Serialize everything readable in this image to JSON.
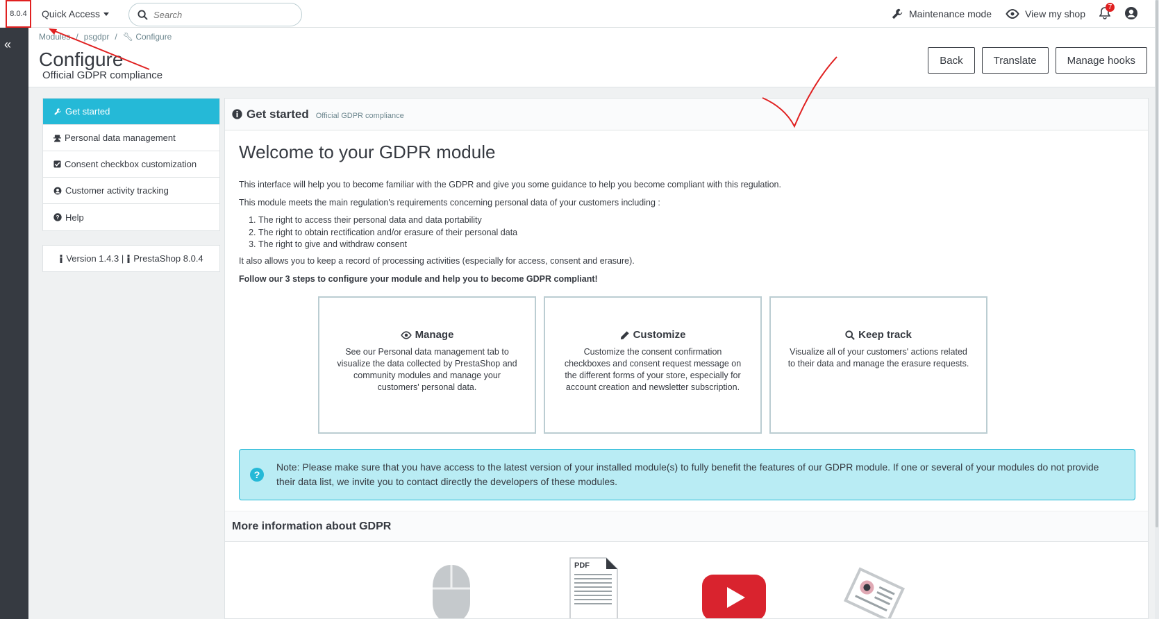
{
  "header": {
    "version": "8.0.4",
    "quick_access": "Quick Access",
    "search_placeholder": "Search",
    "maintenance": "Maintenance mode",
    "view_shop": "View my shop",
    "notifications_count": "7"
  },
  "breadcrumb": {
    "items": [
      "Modules",
      "psgdpr",
      "Configure"
    ]
  },
  "page": {
    "title": "Configure",
    "subtitle": "Official GDPR compliance",
    "actions": {
      "back": "Back",
      "translate": "Translate",
      "manage_hooks": "Manage hooks"
    }
  },
  "nav": {
    "items": [
      {
        "label": "Get started",
        "icon": "wrench-icon"
      },
      {
        "label": "Personal data management",
        "icon": "user-secret-icon"
      },
      {
        "label": "Consent checkbox customization",
        "icon": "checkbox-icon"
      },
      {
        "label": "Customer activity tracking",
        "icon": "user-circle-icon"
      },
      {
        "label": "Help",
        "icon": "question-circle-icon"
      }
    ],
    "version_text": "Version 1.4.3 |",
    "prestashop_text": "PrestaShop 8.0.4"
  },
  "main": {
    "panel_title": "Get started",
    "panel_subtitle": "Official GDPR compliance",
    "welcome": "Welcome to your GDPR module",
    "p1": "This interface will help you to become familiar with the GDPR and give you some guidance to help you become compliant with this regulation.",
    "p2": "This module meets the main regulation's requirements concerning personal data of your customers including :",
    "rights": [
      "The right to access their personal data and data portability",
      "The right to obtain rectification and/or erasure of their personal data",
      "The right to give and withdraw consent"
    ],
    "p3": "It also allows you to keep a record of processing activities (especially for access, consent and erasure).",
    "p4": "Follow our 3 steps to configure your module and help you to become GDPR compliant!",
    "cards": [
      {
        "title": "Manage",
        "icon": "eye-icon",
        "text": "See our Personal data management tab to visualize the data collected by PrestaShop and community modules and manage your customers' personal data."
      },
      {
        "title": "Customize",
        "icon": "pencil-icon",
        "text": "Customize the consent confirmation checkboxes and consent request message on the different forms of your store, especially for account creation and newsletter subscription."
      },
      {
        "title": "Keep track",
        "icon": "search-icon",
        "text": "Visualize all of your customers' actions related to their data and manage the erasure requests."
      }
    ],
    "note": "Note: Please make sure that you have access to the latest version of your installed module(s) to fully benefit the features of our GDPR module. If one or several of your modules do not provide their data list, we invite you to contact directly the developers of these modules.",
    "more_title": "More information about GDPR",
    "more_icons": [
      "mouse-icon",
      "pdf-icon",
      "youtube-icon",
      "newspaper-icon"
    ],
    "pdf_label": "PDF"
  },
  "colors": {
    "accent": "#25b9d7",
    "note_bg": "#b9ecf4",
    "annotation": "#e02020",
    "sidebar": "#363a41"
  }
}
